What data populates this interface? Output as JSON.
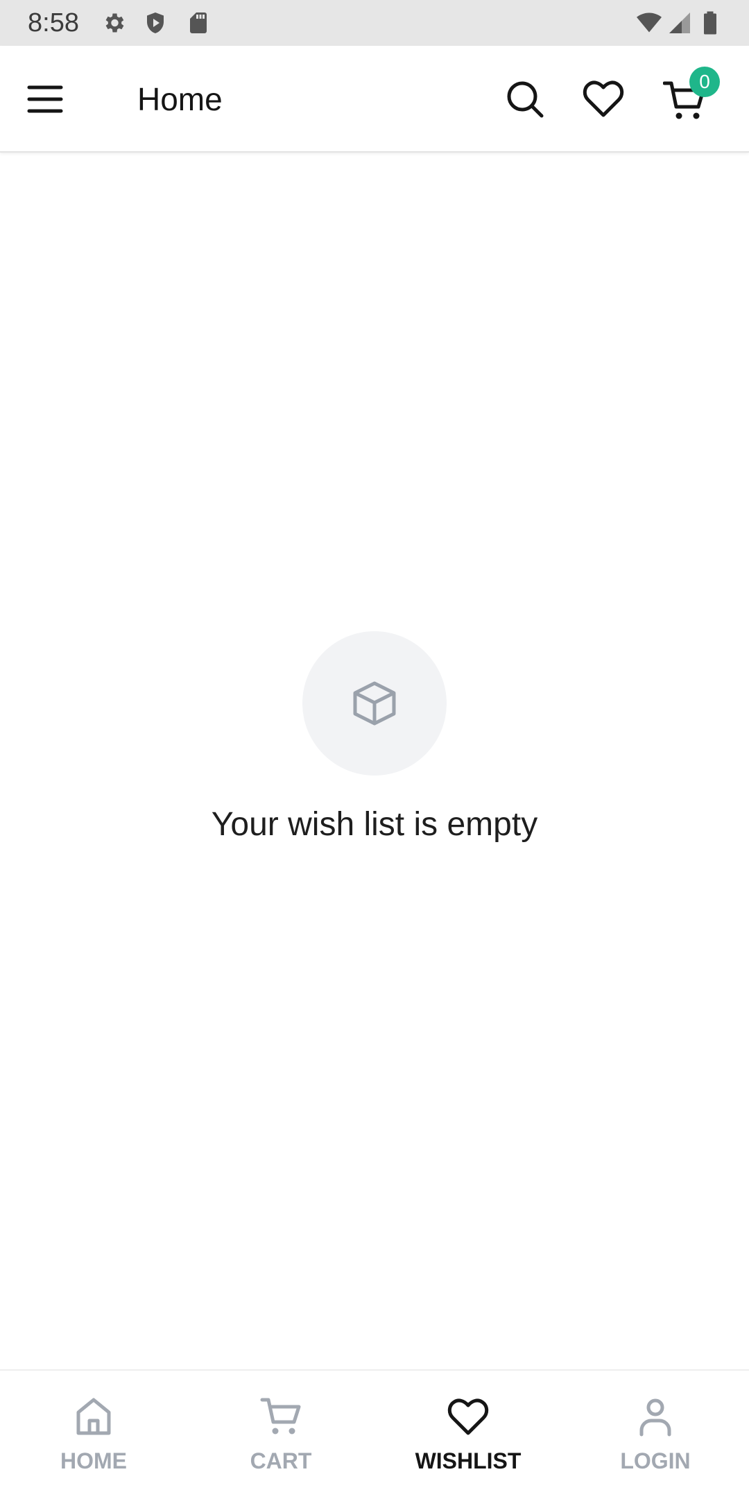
{
  "status_bar": {
    "time": "8:58",
    "icons": [
      "settings-icon",
      "shield-icon",
      "sd-card-icon",
      "wifi-icon",
      "signal-icon",
      "battery-icon"
    ]
  },
  "app_bar": {
    "menu_icon": "hamburger-menu-icon",
    "title": "Home",
    "search_icon": "search-icon",
    "wishlist_icon": "heart-icon",
    "cart_icon": "cart-icon",
    "cart_count": "0",
    "badge_color": "#1fb68a"
  },
  "empty_state": {
    "icon": "box-icon",
    "message": "Your wish list is empty"
  },
  "bottom_nav": {
    "items": [
      {
        "label": "HOME",
        "icon": "home-icon",
        "active": false
      },
      {
        "label": "CART",
        "icon": "cart-icon",
        "active": false
      },
      {
        "label": "WISHLIST",
        "icon": "heart-icon",
        "active": true
      },
      {
        "label": "LOGIN",
        "icon": "user-icon",
        "active": false
      }
    ],
    "active_color": "#151515",
    "inactive_color": "#a2a8b1"
  }
}
